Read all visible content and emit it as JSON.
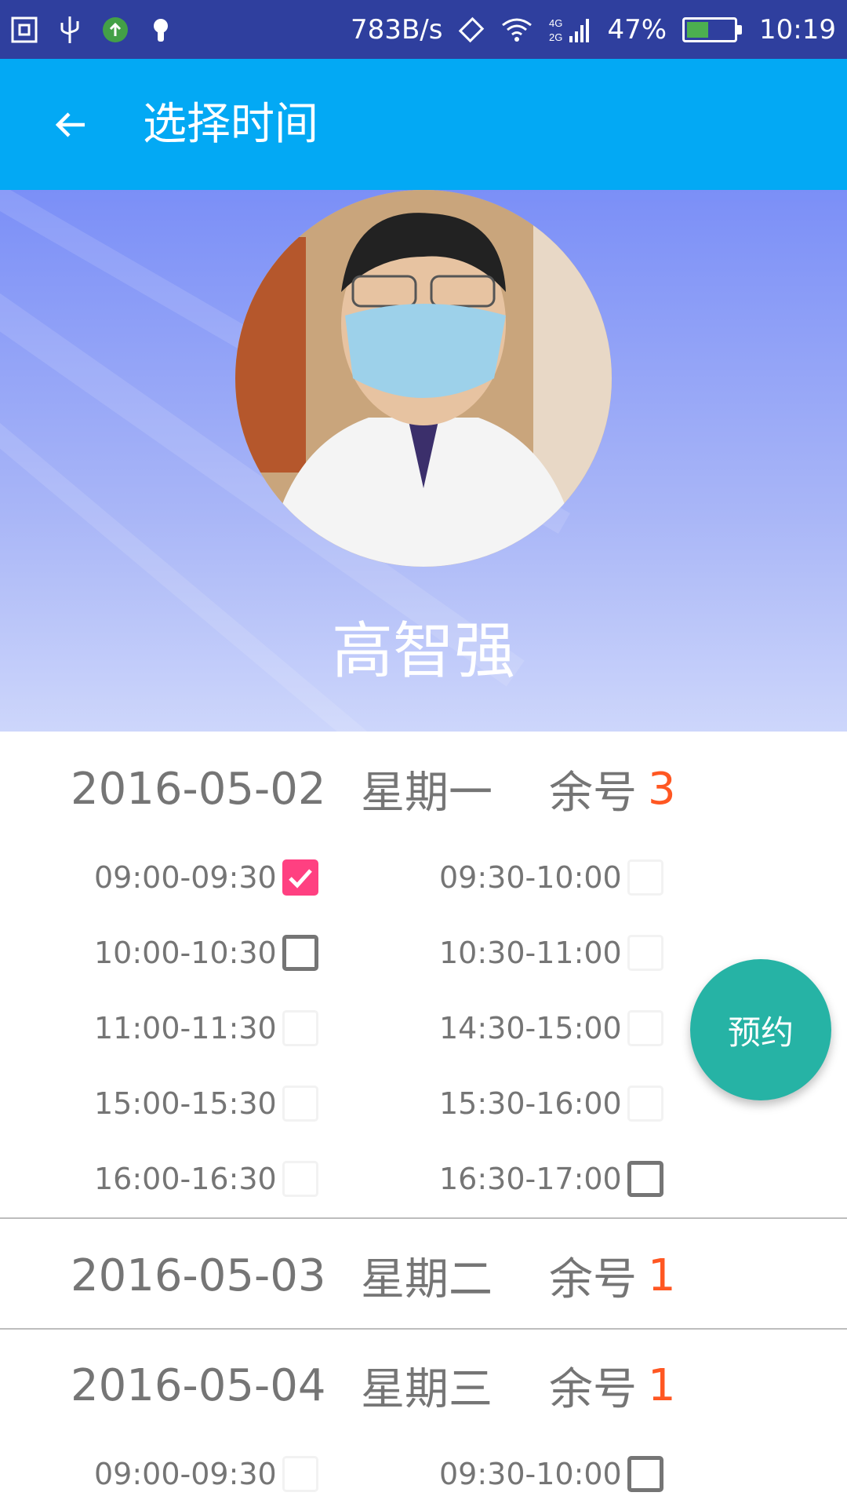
{
  "status_bar": {
    "net_speed": "783B/s",
    "signal_label": "4G 2G",
    "battery_percent": "47%",
    "time": "10:19",
    "battery_level": 0.47,
    "icons": [
      "screenshot-icon",
      "usb-icon",
      "upload-icon",
      "android-icon",
      "vibrate-icon",
      "wifi-icon",
      "signal-icon",
      "battery-icon"
    ]
  },
  "appbar": {
    "title": "选择时间",
    "back_icon": "arrow-left-icon"
  },
  "doctor": {
    "name": "高智强"
  },
  "days": [
    {
      "date": "2016-05-02",
      "weekday": "星期一",
      "remaining_label": "余号",
      "remaining": "3",
      "slots": [
        {
          "time": "09:00-09:30",
          "state": "checked"
        },
        {
          "time": "09:30-10:00",
          "state": "disabled"
        },
        {
          "time": "10:00-10:30",
          "state": "unchecked"
        },
        {
          "time": "10:30-11:00",
          "state": "disabled"
        },
        {
          "time": "11:00-11:30",
          "state": "disabled"
        },
        {
          "time": "14:30-15:00",
          "state": "disabled"
        },
        {
          "time": "15:00-15:30",
          "state": "disabled"
        },
        {
          "time": "15:30-16:00",
          "state": "disabled"
        },
        {
          "time": "16:00-16:30",
          "state": "disabled"
        },
        {
          "time": "16:30-17:00",
          "state": "unchecked"
        }
      ]
    },
    {
      "date": "2016-05-03",
      "weekday": "星期二",
      "remaining_label": "余号",
      "remaining": "1",
      "slots": []
    },
    {
      "date": "2016-05-04",
      "weekday": "星期三",
      "remaining_label": "余号",
      "remaining": "1",
      "slots": [
        {
          "time": "09:00-09:30",
          "state": "disabled"
        },
        {
          "time": "09:30-10:00",
          "state": "unchecked"
        }
      ]
    }
  ],
  "fab": {
    "label": "预约"
  },
  "colors": {
    "status_bar": "#2f3f9e",
    "appbar": "#03a9f4",
    "checked": "#ff4081",
    "remaining": "#ff5722",
    "fab": "#26b3a5"
  }
}
